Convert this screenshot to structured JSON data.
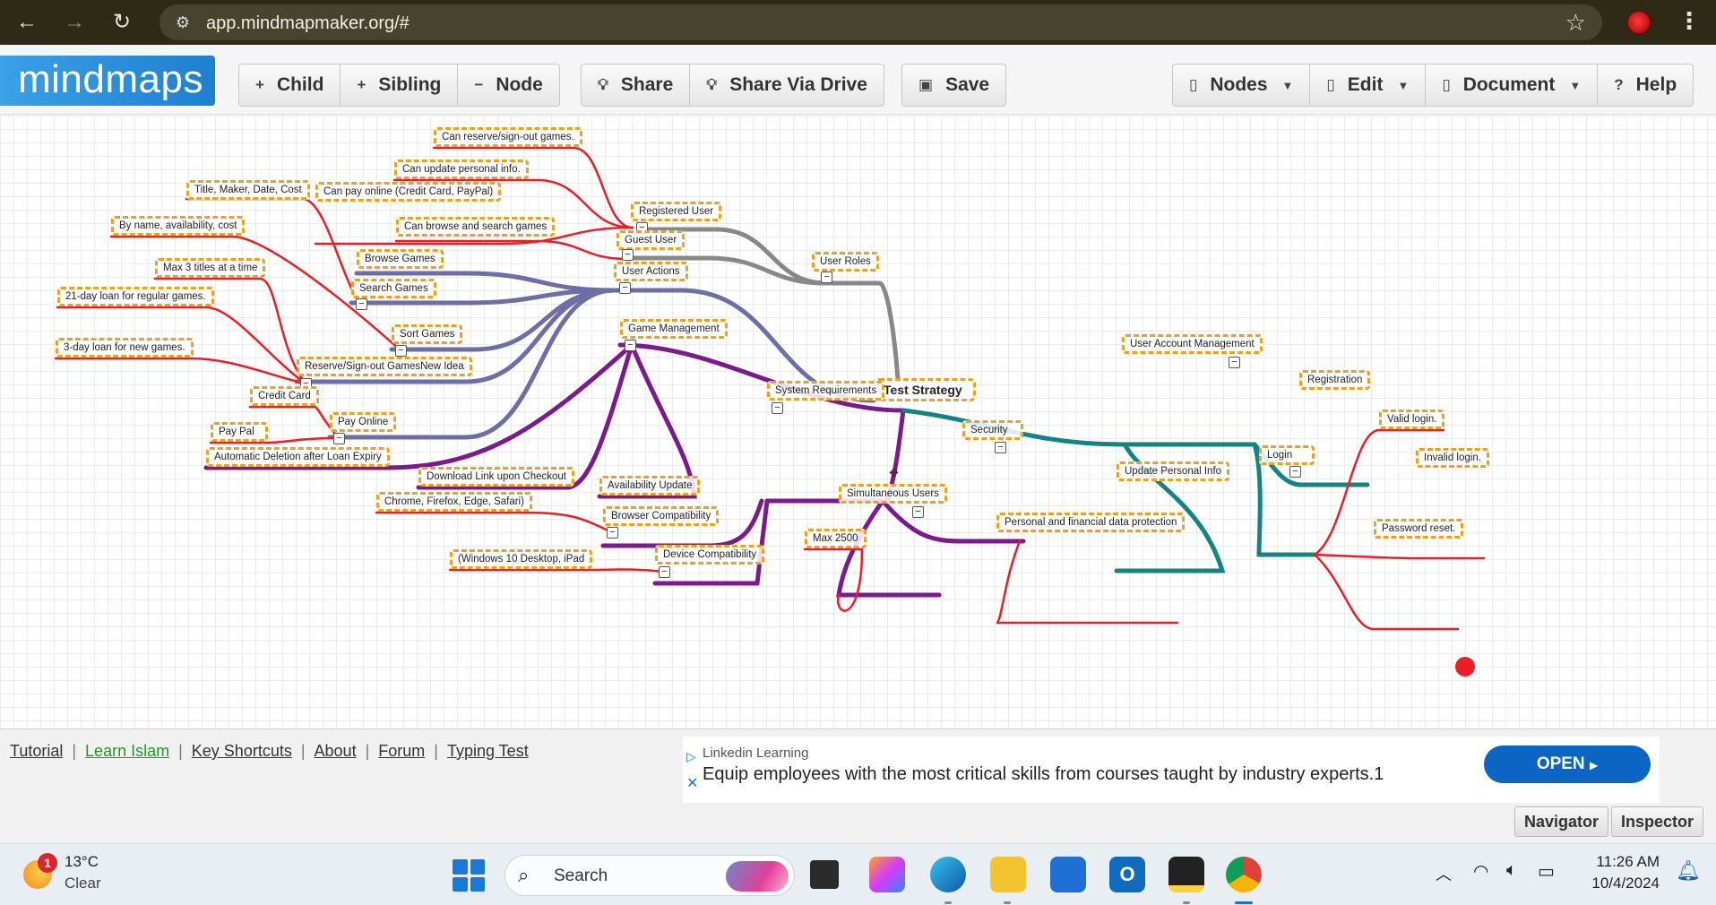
{
  "browser": {
    "url": "app.mindmapmaker.org/#",
    "back_icon": "←",
    "forward_icon": "→",
    "reload_icon": "↻",
    "star_icon": "☆",
    "menu_icon": "⋮"
  },
  "app": {
    "logo": "mindmaps",
    "toolbar": {
      "child": "Child",
      "sibling": "Sibling",
      "node": "Node",
      "share": "Share",
      "share_drive": "Share Via Drive",
      "save": "Save",
      "nodes_menu": "Nodes",
      "edit_menu": "Edit",
      "document_menu": "Document",
      "help": "Help"
    }
  },
  "mindmap": {
    "colors": {
      "gray": "#888888",
      "blue": "#6e6ea6",
      "purple": "#7a1a8c",
      "teal": "#138484",
      "red": "#ee1c25"
    },
    "nodes": {
      "root": "Test Strategy",
      "user_roles": "User Roles",
      "registered_user": "Registered User",
      "guest_user": "Guest User",
      "reg_reserve": "Can reserve/sign-out games.",
      "reg_update": "Can update personal info.",
      "reg_pay": "Can pay online (Credit Card, PayPal)",
      "guest_browse": "Can browse and search games",
      "user_actions": "User Actions",
      "browse_games": "Browse Games",
      "search_games": "Search Games",
      "sort_games": "Sort Games",
      "reserve_signout": "Reserve/Sign-out GamesNew Idea",
      "pay_online": "Pay Online",
      "title_maker": "Title, Maker, Date, Cost",
      "by_name": "By name, availability, cost",
      "max3": "Max 3 titles at a time",
      "loan21": "21-day loan for regular games.",
      "loan3": "3-day loan for new games.",
      "credit_card": "Credit Card",
      "pay_pal": "Pay Pal",
      "game_management": "Game Management",
      "auto_delete": "Automatic Deletion after Loan Expiry",
      "download_link": "Download Link upon Checkout",
      "availability_update": "Availability Update",
      "system_requirements": "System Requirements",
      "browser_compat": "Browser Compatibility",
      "browsers": "Chrome, Firefox, Edge, Safari)",
      "device_compat": "Device Compatibility",
      "devices": "(Windows 10 Desktop, iPad",
      "simultaneous_users": "Simultaneous Users",
      "max2500": "Max 2500",
      "security": "Security",
      "data_protection": "Personal and financial data protection",
      "user_account_mgmt": "User Account Management",
      "registration": "Registration",
      "update_personal": "Update Personal Info",
      "login": "Login",
      "valid_login": "Valid login.",
      "invalid_login": "Invalid login.",
      "password_reset": "Password reset."
    }
  },
  "footer": {
    "links": [
      "Tutorial",
      "Learn Islam",
      "Key Shortcuts",
      "About",
      "Forum",
      "Typing Test"
    ],
    "ad_brand": "Linkedin Learning",
    "ad_text": "Equip employees with the most critical skills from courses taught by industry experts.1",
    "ad_button": "OPEN",
    "navigator": "Navigator",
    "inspector": "Inspector"
  },
  "taskbar": {
    "weather_badge": "1",
    "weather_temp": "13°C",
    "weather_cond": "Clear",
    "search_label": "Search",
    "time": "11:26 AM",
    "date": "10/4/2024"
  }
}
